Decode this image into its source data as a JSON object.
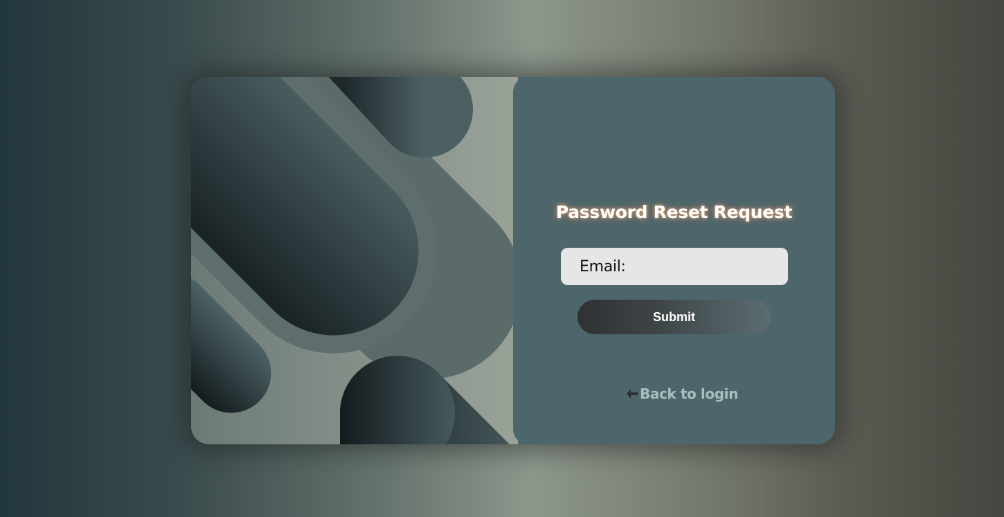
{
  "form": {
    "title": "Password Reset Request",
    "email_label": "Email:",
    "email_value": "",
    "submit_label": "Submit",
    "back_link": "Back to login"
  },
  "icons": {
    "email": "user-icon",
    "back": "arrow-left-icon"
  },
  "colors": {
    "panel": "#4d666c",
    "input_bg": "#e6e6e6",
    "title_glow": "#e8a878",
    "link": "#aabdbf"
  }
}
